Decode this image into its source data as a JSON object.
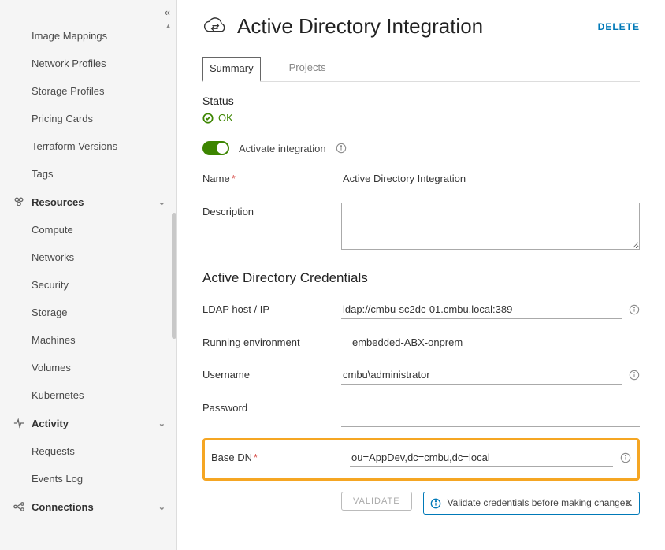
{
  "sidebar": {
    "items_top": [
      "Image Mappings",
      "Network Profiles",
      "Storage Profiles",
      "Pricing Cards",
      "Terraform Versions",
      "Tags"
    ],
    "resources_label": "Resources",
    "resources_items": [
      "Compute",
      "Networks",
      "Security",
      "Storage",
      "Machines",
      "Volumes",
      "Kubernetes"
    ],
    "activity_label": "Activity",
    "activity_items": [
      "Requests",
      "Events Log"
    ],
    "connections_label": "Connections"
  },
  "header": {
    "title": "Active Directory Integration",
    "delete": "DELETE"
  },
  "tabs": {
    "summary": "Summary",
    "projects": "Projects"
  },
  "status": {
    "heading": "Status",
    "ok": "OK"
  },
  "toggle": {
    "label": "Activate integration"
  },
  "form": {
    "name_label": "Name",
    "name_value": "Active Directory Integration",
    "description_label": "Description",
    "description_value": "",
    "creds_heading": "Active Directory Credentials",
    "ldap_label": "LDAP host / IP",
    "ldap_value": "ldap://cmbu-sc2dc-01.cmbu.local:389",
    "running_label": "Running environment",
    "running_value": "embedded-ABX-onprem",
    "username_label": "Username",
    "username_value": "cmbu\\administrator",
    "password_label": "Password",
    "basedn_label": "Base DN",
    "basedn_value": "ou=AppDev,dc=cmbu,dc=local",
    "validate_btn": "VALIDATE",
    "validate_msg": "Validate credentials before making changes."
  }
}
